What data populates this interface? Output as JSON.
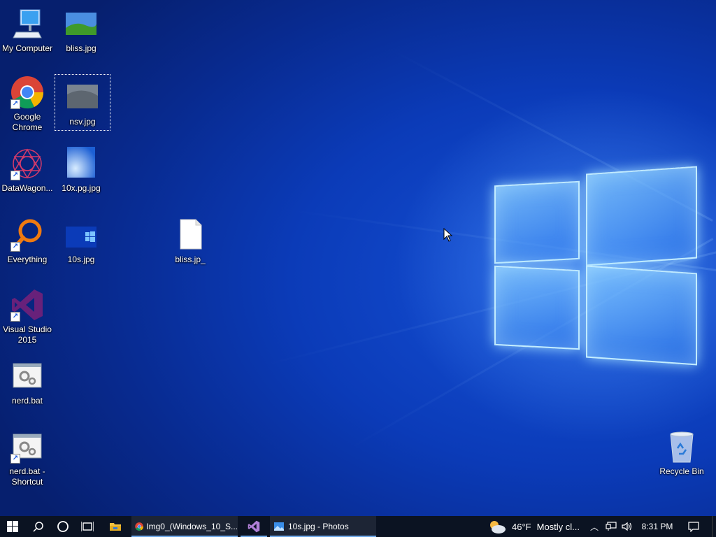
{
  "desktop_icons": {
    "my_computer": "My Computer",
    "chrome_line1": "Google",
    "chrome_line2": "Chrome",
    "datawagon": "DataWagon...",
    "everything": "Everything",
    "vs_line1": "Visual Studio",
    "vs_line2": "2015",
    "nerd_bat": "nerd.bat",
    "nerd_shortcut_line1": "nerd.bat -",
    "nerd_shortcut_line2": "Shortcut",
    "bliss_jpg": "bliss.jpg",
    "nsv_jpg": "nsv.jpg",
    "tenx_jpg": "10x.pg.jpg",
    "tens_jpg": "10s.jpg",
    "bliss_jp_": "bliss.jp_",
    "recycle_bin": "Recycle Bin"
  },
  "taskbar": {
    "apps": [
      {
        "label": "Img0_(Windows_10_S...",
        "icon": "chrome-icon"
      },
      {
        "label": "",
        "icon": "visual-studio-icon"
      },
      {
        "label": "10s.jpg - Photos",
        "icon": "photos-icon"
      }
    ],
    "weather": {
      "temp": "46°F",
      "desc": "Mostly cl..."
    },
    "clock": "8:31 PM"
  },
  "colors": {
    "taskbar": "#0b1322",
    "desktop": "#0b3bb8",
    "accent": "#6ea8e8"
  }
}
